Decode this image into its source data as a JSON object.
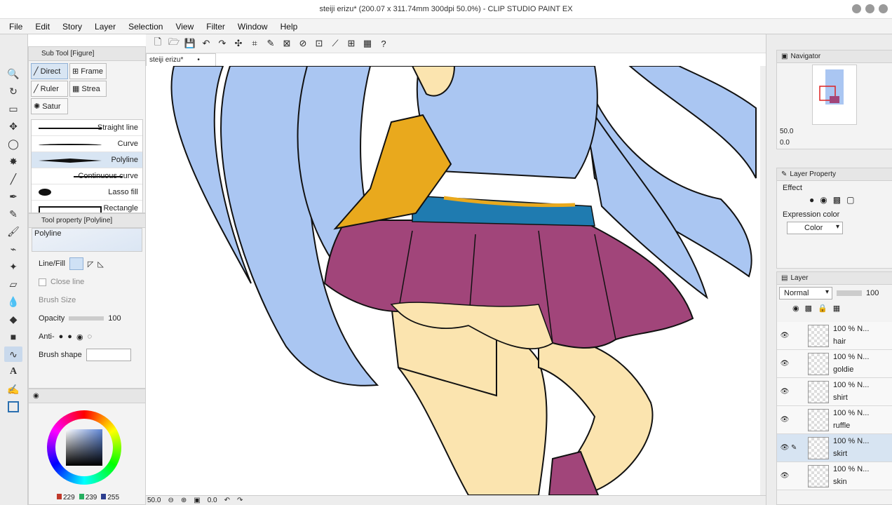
{
  "window": {
    "title": "steiji erizu* (200.07 x 311.74mm 300dpi 50.0%) - CLIP STUDIO PAINT EX"
  },
  "menu": [
    "File",
    "Edit",
    "Story",
    "Layer",
    "Selection",
    "View",
    "Filter",
    "Window",
    "Help"
  ],
  "subtool": {
    "panel_title": "Sub Tool [Figure]",
    "tabs": [
      "Direct",
      "Frame",
      "Ruler",
      "Strea",
      "Satur"
    ],
    "brushes": [
      "Straight line",
      "Curve",
      "Polyline",
      "Continuous curve",
      "Lasso fill",
      "Rectangle"
    ]
  },
  "toolprop": {
    "panel_title": "Tool property [Polyline]",
    "preset_name": "Polyline",
    "line_fill_label": "Line/Fill",
    "close_line_label": "Close line",
    "brush_size_label": "Brush Size",
    "opacity_label": "Opacity",
    "opacity_value": "100",
    "anti_label": "Anti-",
    "brush_shape_label": "Brush shape"
  },
  "color": {
    "r": "229",
    "g": "239",
    "b": "255",
    "swatch_r": "#c0392b",
    "swatch_g": "#27ae60",
    "swatch_b": "#2c3e8f"
  },
  "canvas": {
    "doc_tab": "steiji erizu*",
    "zoom": "50.0",
    "angle": "0.0"
  },
  "navigator": {
    "title": "Navigator",
    "zoom": "50.0",
    "angle": "0.0"
  },
  "layer_property": {
    "title": "Layer Property",
    "effect_label": "Effect",
    "expression_label": "Expression color",
    "expression_value": "Color"
  },
  "layer_panel": {
    "title": "Layer",
    "blend_mode": "Normal",
    "opacity": "100",
    "layers": [
      {
        "pct": "100 %",
        "mode": "N...",
        "name": "hair"
      },
      {
        "pct": "100 %",
        "mode": "N...",
        "name": "goldie"
      },
      {
        "pct": "100 %",
        "mode": "N...",
        "name": "shirt"
      },
      {
        "pct": "100 %",
        "mode": "N...",
        "name": "ruffle"
      },
      {
        "pct": "100 %",
        "mode": "N...",
        "name": "skirt"
      },
      {
        "pct": "100 %",
        "mode": "N...",
        "name": "skin"
      }
    ]
  },
  "art_colors": {
    "hair": "#aac6f2",
    "shirt": "#aac6f2",
    "bow": "#e9a91d",
    "ruffle": "#1f7bb0",
    "skirt": "#a1457a",
    "skin": "#fbe4af"
  }
}
